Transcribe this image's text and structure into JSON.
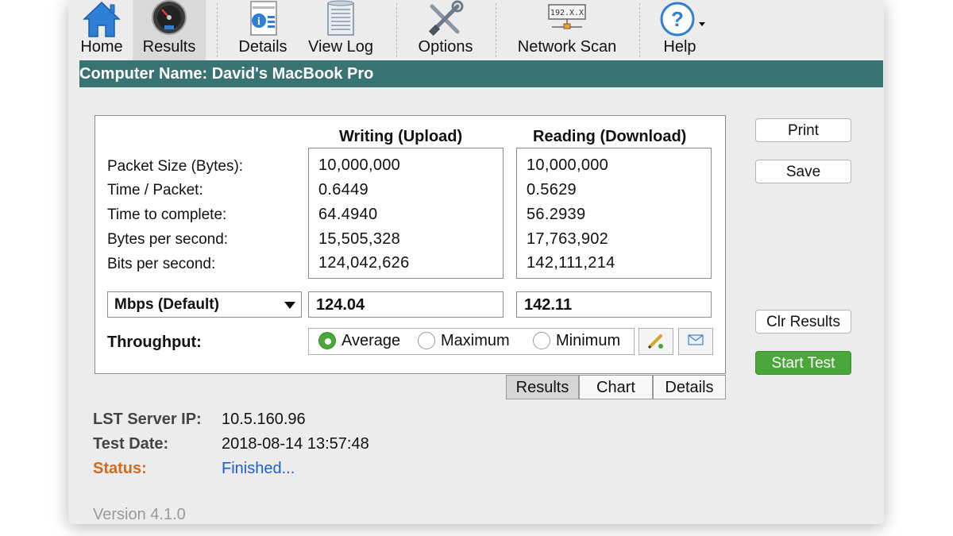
{
  "toolbar": {
    "items": [
      {
        "label": "Home",
        "icon": "home-icon"
      },
      {
        "label": "Results",
        "icon": "speedometer-icon"
      },
      {
        "label": "Details",
        "icon": "info-document-icon"
      },
      {
        "label": "View Log",
        "icon": "log-document-icon"
      },
      {
        "label": "Options",
        "icon": "tools-icon"
      },
      {
        "label": "Network Scan",
        "icon": "network-scan-icon",
        "icon_text": "192.X.X"
      },
      {
        "label": "Help",
        "icon": "help-icon",
        "icon_text": "?"
      }
    ],
    "active": "Results"
  },
  "banner": {
    "text": "Computer Name: David's MacBook Pro"
  },
  "results": {
    "upload_header": "Writing (Upload)",
    "download_header": "Reading (Download)",
    "row_labels": [
      "Packet Size (Bytes):",
      "Time / Packet:",
      "Time to complete:",
      "Bytes per second:",
      "Bits per second:"
    ],
    "upload_values": [
      "10,000,000",
      "0.6449",
      "64.4940",
      "15,505,328",
      "124,042,626"
    ],
    "download_values": [
      "10,000,000",
      "0.5629",
      "56.2939",
      "17,763,902",
      "142,111,214"
    ],
    "unit_select": "Mbps (Default)",
    "upload_mbps": "124.04",
    "download_mbps": "142.11",
    "throughput_label": "Throughput:",
    "throughput_options": [
      "Average",
      "Maximum",
      "Minimum"
    ],
    "throughput_selected": "Average"
  },
  "tabs": {
    "items": [
      "Results",
      "Chart",
      "Details"
    ],
    "active": "Results"
  },
  "info": {
    "server_ip_label": "LST Server IP:",
    "server_ip": "10.5.160.96",
    "test_date_label": "Test Date:",
    "test_date": "2018-08-14 13:57:48",
    "status_label": "Status:",
    "status": "Finished..."
  },
  "buttons": {
    "print": "Print",
    "save": "Save",
    "clear": "Clr Results",
    "start": "Start Test"
  },
  "version": "Version 4.1.0",
  "colors": {
    "banner": "#3a7472",
    "accent_green": "#4aa83a",
    "status_label": "#d2691e",
    "status_value": "#1a5fd1"
  }
}
